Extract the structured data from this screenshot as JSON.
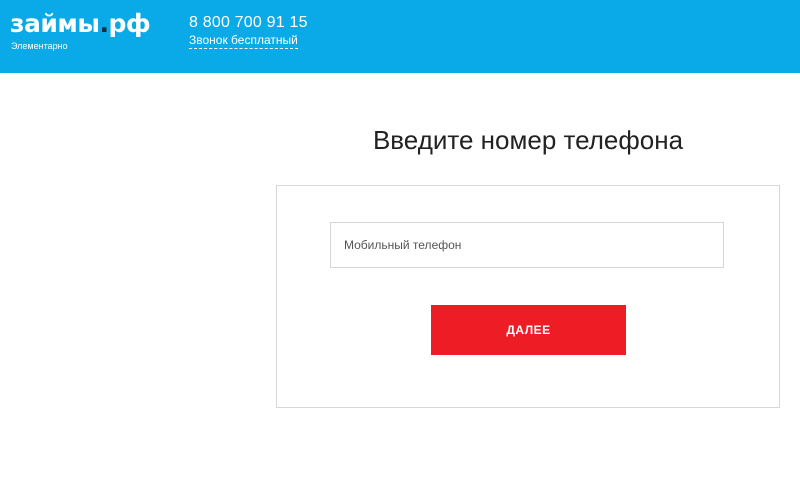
{
  "header": {
    "logo_main": "займы",
    "logo_dot": ".",
    "logo_suffix": "рф",
    "tagline": "Элементарно",
    "phone": "8 800 700 91 15",
    "free_call": "Звонок бесплатный",
    "background_color": "#0aaae8"
  },
  "main": {
    "title": "Введите номер телефона",
    "phone_input": {
      "placeholder": "Мобильный телефон",
      "value": ""
    },
    "next_button_label": "ДАЛЕЕ",
    "accent_color": "#ee1c25"
  }
}
